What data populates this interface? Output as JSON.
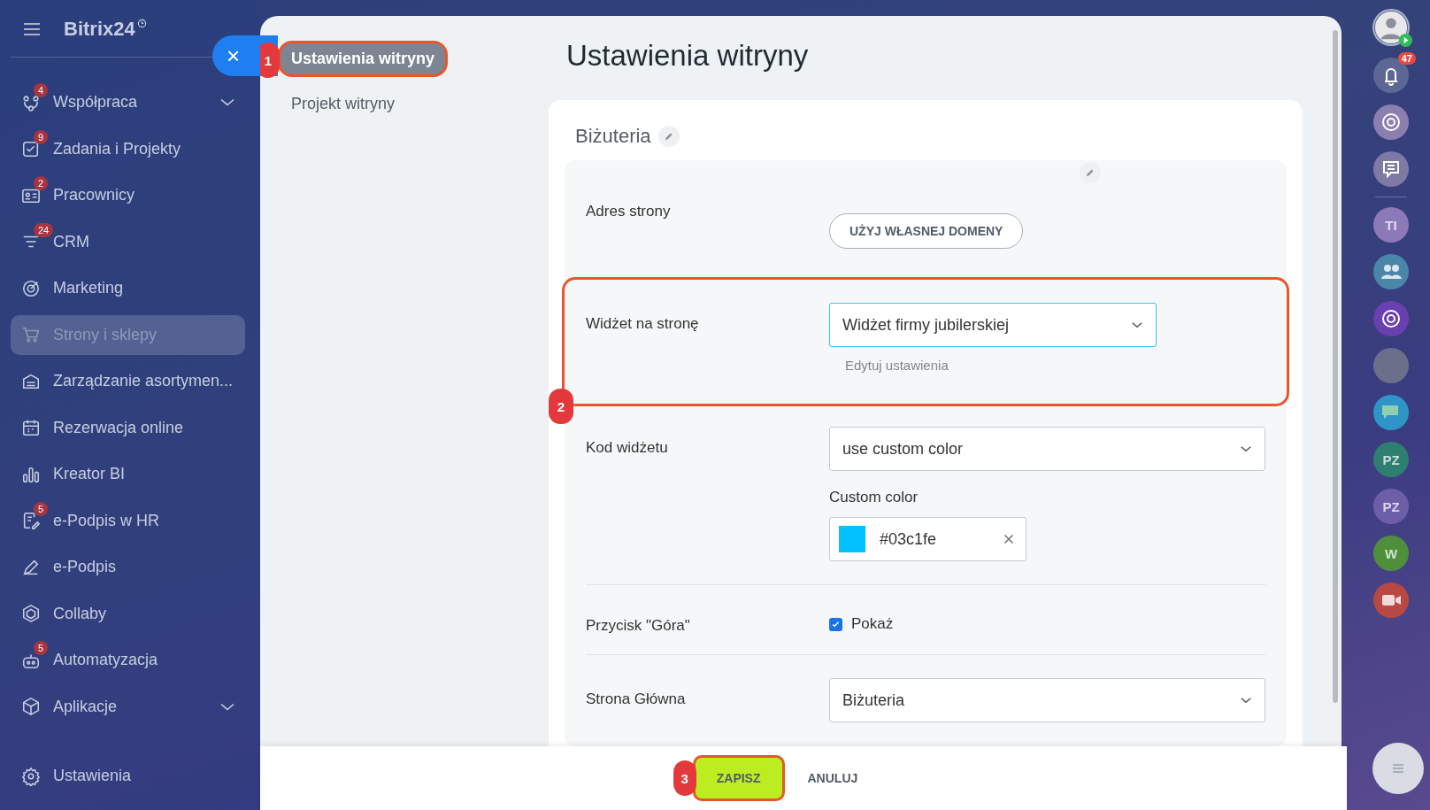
{
  "sidebar": {
    "logo": "Bitrix24",
    "items": [
      {
        "label": "Współpraca",
        "badge": "4",
        "has_submenu": true,
        "selected": false
      },
      {
        "label": "Zadania i Projekty",
        "badge": "9",
        "has_submenu": false,
        "selected": false
      },
      {
        "label": "Pracownicy",
        "badge": "2",
        "has_submenu": false,
        "selected": false
      },
      {
        "label": "CRM",
        "badge": "24",
        "has_submenu": false,
        "selected": false
      },
      {
        "label": "Marketing",
        "has_submenu": false,
        "selected": false
      },
      {
        "label": "Strony i sklepy",
        "has_submenu": false,
        "selected": true
      },
      {
        "label": "Zarządzanie asortymen...",
        "has_submenu": false,
        "selected": false
      },
      {
        "label": "Rezerwacja online",
        "has_submenu": false,
        "selected": false
      },
      {
        "label": "Kreator BI",
        "has_submenu": false,
        "selected": false
      },
      {
        "label": "e-Podpis w HR",
        "badge": "5",
        "has_submenu": false,
        "selected": false
      },
      {
        "label": "e-Podpis",
        "has_submenu": false,
        "selected": false
      },
      {
        "label": "Collaby",
        "has_submenu": false,
        "selected": false
      },
      {
        "label": "Automatyzacja",
        "badge": "5",
        "has_submenu": false,
        "selected": false
      },
      {
        "label": "Aplikacje",
        "has_submenu": true,
        "selected": false
      }
    ],
    "settings": "Ustawienia"
  },
  "panel": {
    "close": "×",
    "nav": [
      {
        "label": "Ustawienia witryny",
        "selected": true,
        "annotation": "1"
      },
      {
        "label": "Projekt witryny",
        "selected": false
      }
    ],
    "title": "Ustawienia witryny",
    "card": {
      "title": "Biżuteria",
      "rows": [
        {
          "kind": "address",
          "label": "Adres strony",
          "button": "UŻYJ WŁASNEJ DOMENY"
        },
        {
          "kind": "select",
          "label": "Widżet na stronę",
          "value": "Widżet firmy jubilerskiej",
          "link": "Edytuj ustawienia",
          "annotation": "2"
        },
        {
          "kind": "color_select",
          "label": "Kod widżetu",
          "value": "use custom color",
          "sub_label": "Custom color",
          "color_value": "#03c1fe",
          "color": "#03c1fe"
        },
        {
          "kind": "checkbox",
          "label": "Przycisk \"Góra\"",
          "option": "Pokaż",
          "checked": true
        },
        {
          "kind": "select",
          "label": "Strona Główna",
          "value": "Biżuteria"
        }
      ]
    },
    "footer": {
      "save": "ZAPISZ",
      "save_annotation": "3",
      "cancel": "ANULUJ"
    }
  },
  "rightbar": [
    {
      "kind": "user"
    },
    {
      "kind": "bell",
      "badge": "47"
    },
    {
      "kind": "ring",
      "color": "#8a7fae"
    },
    {
      "kind": "swap",
      "color": "#7d7aa6"
    },
    {
      "kind": "initials",
      "text": "TI",
      "color": "#8c79b8"
    },
    {
      "kind": "group",
      "color": "#4a86a8"
    },
    {
      "kind": "ring",
      "color": "#6a3fb0"
    },
    {
      "kind": "photo",
      "color": "#6b6f8a"
    },
    {
      "kind": "chat",
      "color": "#2f94c8"
    },
    {
      "kind": "initials",
      "text": "PZ",
      "color": "#2f7f70"
    },
    {
      "kind": "initials",
      "text": "PZ",
      "color": "#6d5ea8"
    },
    {
      "kind": "initials",
      "text": "W",
      "color": "#4f8f3c"
    },
    {
      "kind": "video",
      "color": "#b84842"
    }
  ]
}
